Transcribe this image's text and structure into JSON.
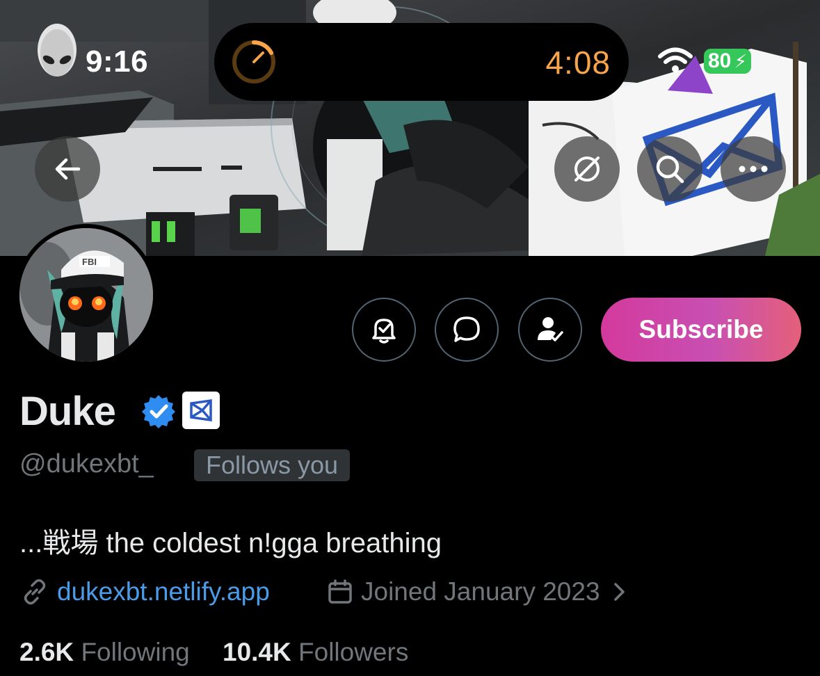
{
  "status_bar": {
    "time": "9:16",
    "activity_timer": "4:08",
    "battery": "80",
    "icons": [
      "alien-icon",
      "timer-ring-icon",
      "wifi-icon",
      "battery-icon",
      "charging-bolt-icon"
    ]
  },
  "header_buttons": {
    "icons": [
      "back-arrow-icon",
      "grok-icon",
      "search-icon",
      "more-icon"
    ]
  },
  "profile": {
    "name": "Duke",
    "handle": "@dukexbt_",
    "follows_you": "Follows you",
    "bio": "...戦場 the coldest n!gga breathing",
    "website": "dukexbt.netlify.app",
    "joined": "Joined January 2023",
    "following_count": "2.6K",
    "following_label": "Following",
    "followers_count": "10.4K",
    "followers_label": "Followers",
    "badges": [
      "verified-badge-icon",
      "affiliate-org-icon"
    ]
  },
  "actions": {
    "subscribe_label": "Subscribe",
    "icons": [
      "bell-check-icon",
      "message-icon",
      "user-check-icon",
      "link-icon",
      "calendar-icon",
      "chevron-right-icon"
    ]
  },
  "colors": {
    "background": "#000000",
    "text_primary": "#e7e9ea",
    "text_secondary": "#71767b",
    "link": "#4b9ce8",
    "timer": "#f7a54a",
    "battery": "#35c759",
    "subscribe_gradient_start": "#d33a9c",
    "subscribe_gradient_end": "#e4607a",
    "verified": "#2f8cf0"
  }
}
